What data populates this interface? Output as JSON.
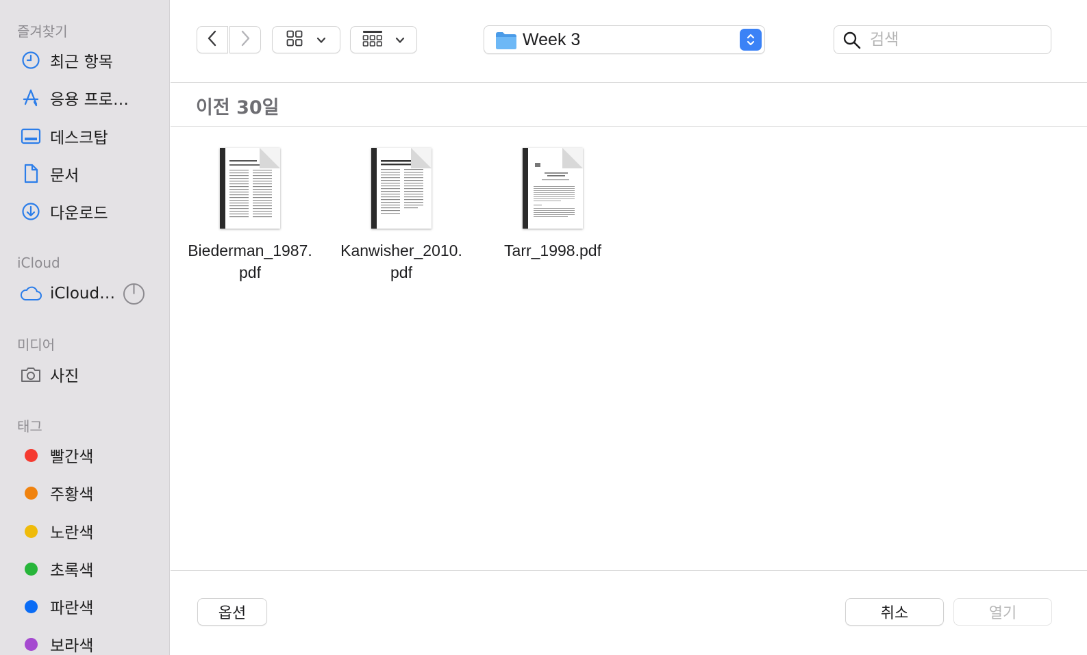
{
  "sidebar": {
    "favorites_header": "즐겨찾기",
    "favorites": [
      {
        "label": "최근 항목",
        "icon": "clock-icon"
      },
      {
        "label": "응용 프로…",
        "icon": "app-store-icon"
      },
      {
        "label": "데스크탑",
        "icon": "desktop-icon"
      },
      {
        "label": "문서",
        "icon": "document-icon"
      },
      {
        "label": "다운로드",
        "icon": "download-icon"
      }
    ],
    "icloud_header": "iCloud",
    "icloud_item": {
      "label": "iCloud…",
      "icon": "cloud-icon"
    },
    "media_header": "미디어",
    "media_item": {
      "label": "사진",
      "icon": "camera-icon"
    },
    "tags_header": "태그",
    "tags": [
      {
        "label": "빨간색",
        "color": "#f53a30"
      },
      {
        "label": "주황색",
        "color": "#f0820e"
      },
      {
        "label": "노란색",
        "color": "#efbb0a"
      },
      {
        "label": "초록색",
        "color": "#27b53a"
      },
      {
        "label": "파란색",
        "color": "#0a6cf5"
      },
      {
        "label": "보라색",
        "color": "#a54ad0"
      }
    ]
  },
  "toolbar": {
    "path_label": "Week 3",
    "search_placeholder": "검색"
  },
  "group_title": "이전 30일",
  "files": [
    {
      "name": "Biederman_1987.\npdf"
    },
    {
      "name": "Kanwisher_2010.\npdf"
    },
    {
      "name": "Tarr_1998.pdf"
    }
  ],
  "buttons": {
    "options": "옵션",
    "cancel": "취소",
    "open": "열기"
  },
  "colors": {
    "accent": "#3b82f6",
    "folder": "#5aaaf0"
  }
}
